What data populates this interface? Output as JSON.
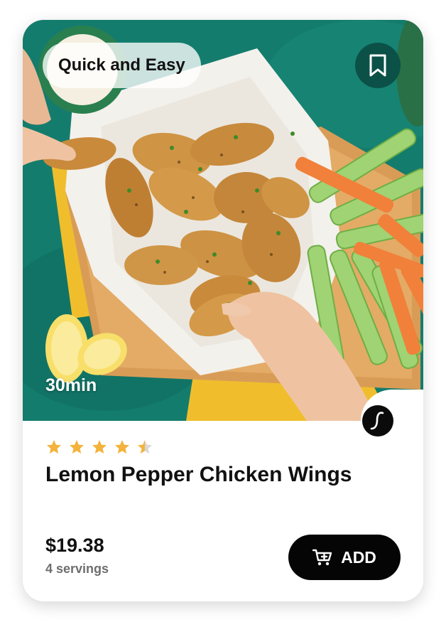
{
  "recipe": {
    "tag": "Quick and Easy",
    "time": "30min",
    "title": "Lemon Pepper Chicken Wings",
    "rating": 4.5,
    "rating_max": 5,
    "price": "$19.38",
    "servings": "4 servings"
  },
  "actions": {
    "add_label": "ADD"
  },
  "icons": {
    "bookmark": "bookmark-icon",
    "brand": "brand-logo-icon",
    "cart": "cart-plus-icon",
    "star": "star-icon"
  },
  "colors": {
    "star": "#f3b33c",
    "star_empty": "#d8d8d8",
    "button": "#050505",
    "bookmark_bg": "#0c5148",
    "photo_bg": "#137a6b"
  }
}
